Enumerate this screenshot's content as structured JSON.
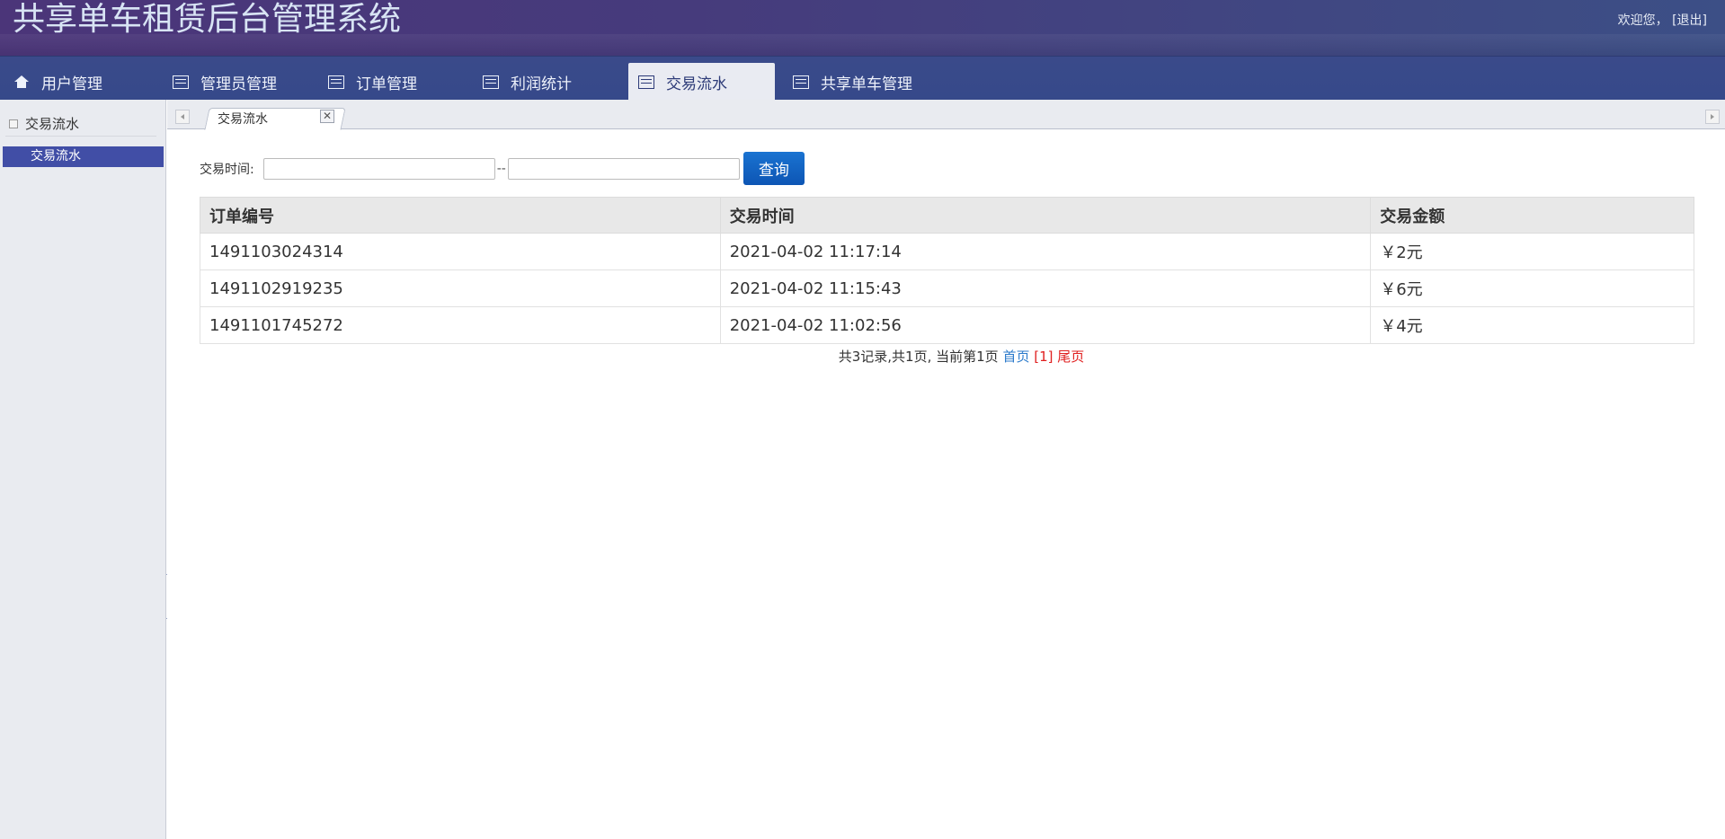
{
  "app": {
    "title": "共享单车租赁后台管理系统",
    "welcome": "欢迎您，",
    "logout": "[退出]"
  },
  "nav": {
    "items": [
      {
        "label": "用户管理",
        "icon": "home-icon"
      },
      {
        "label": "管理员管理",
        "icon": "list-icon"
      },
      {
        "label": "订单管理",
        "icon": "list-icon"
      },
      {
        "label": "利润统计",
        "icon": "list-icon"
      },
      {
        "label": "交易流水",
        "icon": "list-icon",
        "active": true
      },
      {
        "label": "共享单车管理",
        "icon": "list-icon"
      }
    ]
  },
  "sidebar": {
    "group_title": "交易流水",
    "items": [
      {
        "label": "交易流水",
        "selected": true
      }
    ]
  },
  "tabs": {
    "open": [
      {
        "label": "交易流水"
      }
    ],
    "close_symbol": "✕"
  },
  "filter": {
    "label": "交易时间:",
    "separator": "--",
    "start_value": "",
    "end_value": "",
    "query_label": "查询"
  },
  "table": {
    "headers": [
      "订单编号",
      "交易时间",
      "交易金额"
    ],
    "rows": [
      [
        "1491103024314",
        "2021-04-02 11:17:14",
        "￥2元"
      ],
      [
        "1491102919235",
        "2021-04-02 11:15:43",
        "￥6元"
      ],
      [
        "1491101745272",
        "2021-04-02 11:02:56",
        "￥4元"
      ]
    ]
  },
  "pager": {
    "summary": "共3记录,共1页, 当前第1页 ",
    "first": "首页",
    "current": " [1] ",
    "last": "尾页"
  },
  "colors": {
    "nav_active_bg": "#e9ebf2",
    "sidebar_selected_bg": "#414ea6",
    "query_button": "#0d55b4",
    "link_blue": "#2b7acb",
    "link_red": "#e02020"
  }
}
